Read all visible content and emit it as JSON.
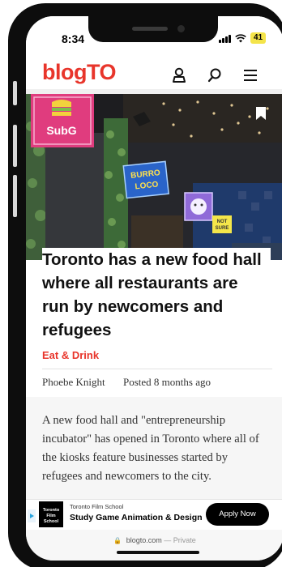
{
  "status_bar": {
    "time": "8:34",
    "battery": "41"
  },
  "header": {
    "logo": "blogTO"
  },
  "hero_signs": {
    "sign1": "SubG",
    "sign2_line1": "BURRO",
    "sign2_line2": "LOCO",
    "sign4_line1": "NOT",
    "sign4_line2": "SURE"
  },
  "article": {
    "headline": "Toronto has a new food hall where all restaurants are run by newcomers and refugees",
    "category": "Eat & Drink",
    "author": "Phoebe Knight",
    "posted": "Posted 8 months ago",
    "body": "A new food hall and \"entrepreneurship incubator\" has opened in Toronto where all of the kiosks feature businesses started by refugees and newcomers to the city."
  },
  "ad": {
    "logo_line1": "Toronto",
    "logo_line2": "Film",
    "logo_line3": "School",
    "org": "Toronto Film School",
    "title": "Study Game Animation & Design",
    "cta": "Apply Now"
  },
  "browser": {
    "domain": "blogto.com",
    "separator": "—",
    "mode": "Private"
  },
  "colors": {
    "brand": "#e8352b",
    "battery": "#f4e44a",
    "ad_button": "#000000"
  }
}
